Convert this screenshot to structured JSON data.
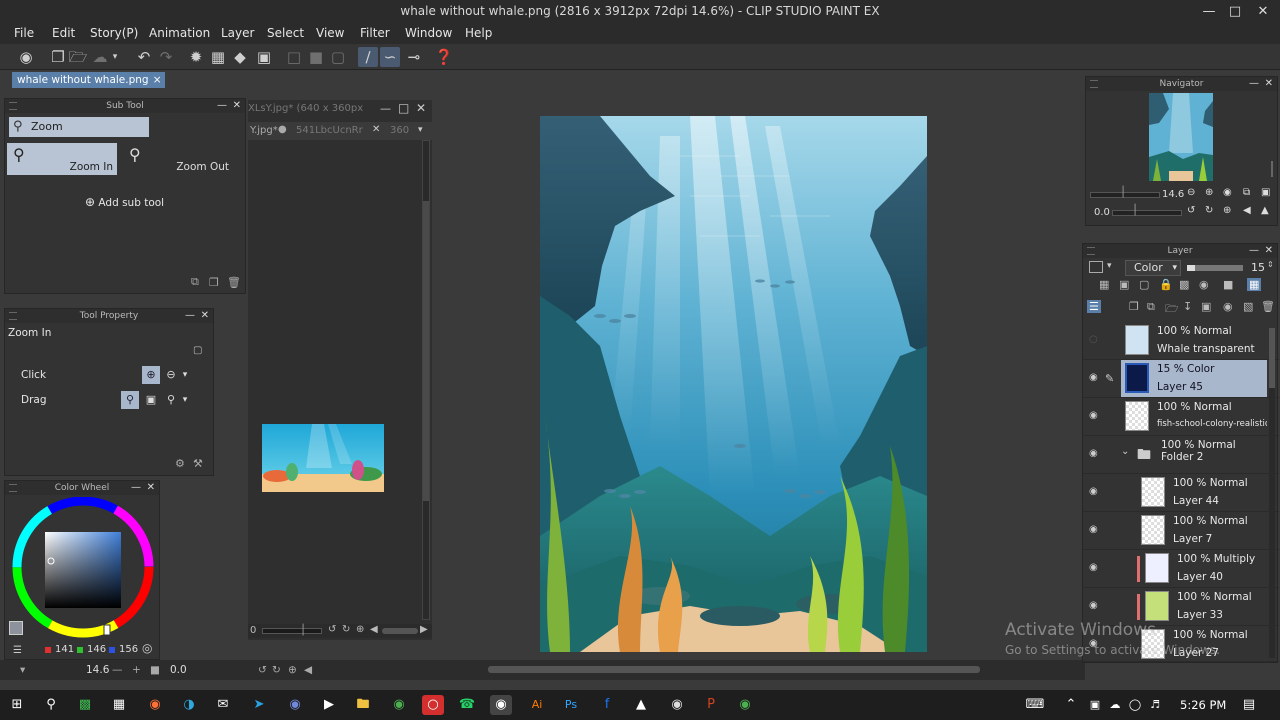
{
  "window": {
    "title": "whale without whale.png (2816 x 3912px 72dpi 14.6%)  - CLIP STUDIO PAINT EX"
  },
  "menu": [
    "File",
    "Edit",
    "Story(P)",
    "Animation",
    "Layer",
    "Select",
    "View",
    "Filter",
    "Window",
    "Help"
  ],
  "doc_tab": "whale without whale.png",
  "sub_tool": {
    "title": "Sub Tool",
    "group": "Zoom",
    "zoom_in": "Zoom In",
    "zoom_out": "Zoom Out",
    "add": "Add sub tool"
  },
  "tool_property": {
    "title": "Tool Property",
    "tool_name": "Zoom In",
    "click_label": "Click",
    "drag_label": "Drag"
  },
  "color_wheel": {
    "title": "Color Wheel",
    "r": "141",
    "g": "146",
    "b": "156",
    "hue_color": "#3f7fd8"
  },
  "inner_doc": {
    "title": "XLsY.jpg* (640 x 360px",
    "tab1": "Y.jpg*",
    "tab2": "541LbcUcnRr",
    "tab3": "360",
    "zoom": "0"
  },
  "statusbar": {
    "zoom": "14.6",
    "angle": "0.0"
  },
  "navigator": {
    "title": "Navigator",
    "zoom": "14.6",
    "angle": "0.0"
  },
  "layer_panel": {
    "title": "Layer",
    "blend_mode": "Color",
    "opacity": "15",
    "layers": [
      {
        "mode": "100 % Normal",
        "name": "Whale transparent",
        "selected": false
      },
      {
        "mode": "15 % Color",
        "name": "Layer 45",
        "selected": true
      },
      {
        "mode": "100 % Normal",
        "name": "fish-school-colony-realistic-com",
        "selected": false
      },
      {
        "mode": "100 % Normal",
        "name": "Folder 2",
        "selected": false
      },
      {
        "mode": "100 % Normal",
        "name": "Layer 44",
        "selected": false
      },
      {
        "mode": "100 % Normal",
        "name": "Layer 7",
        "selected": false
      },
      {
        "mode": "100 % Multiply",
        "name": "Layer 40",
        "selected": false
      },
      {
        "mode": "100 % Normal",
        "name": "Layer 33",
        "selected": false
      },
      {
        "mode": "100 % Normal",
        "name": "Layer 27",
        "selected": false
      }
    ]
  },
  "watermark": {
    "line1": "Activate Windows",
    "line2": "Go to Settings to activate Windows."
  },
  "taskbar": {
    "time": "5:26 PM"
  }
}
